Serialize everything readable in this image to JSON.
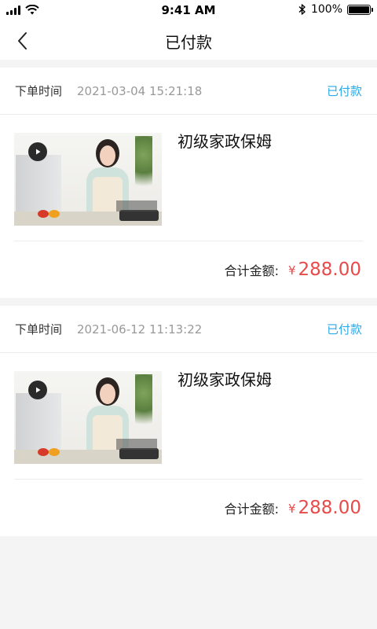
{
  "status_bar": {
    "time": "9:41 AM",
    "battery_text": "100%"
  },
  "nav": {
    "title": "已付款"
  },
  "orders": [
    {
      "time_label": "下单时间",
      "time": "2021-03-04 15:21:18",
      "status": "已付款",
      "product_title": "初级家政保姆",
      "total_label": "合计金额:",
      "currency": "¥",
      "amount": "288.00"
    },
    {
      "time_label": "下单时间",
      "time": "2021-06-12 11:13:22",
      "status": "已付款",
      "product_title": "初级家政保姆",
      "total_label": "合计金额:",
      "currency": "¥",
      "amount": "288.00"
    }
  ],
  "colors": {
    "status_accent": "#2aaae6",
    "price": "#e84a4a"
  }
}
